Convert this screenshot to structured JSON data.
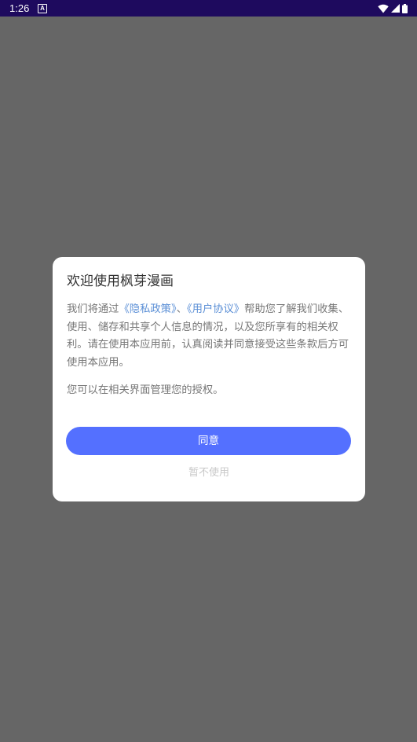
{
  "status_bar": {
    "time": "1:26",
    "notification_letter": "A",
    "icons": [
      "wifi-icon",
      "signal-icon",
      "battery-icon"
    ]
  },
  "dialog": {
    "title": "欢迎使用枫芽漫画",
    "body_part1": "我们将通过",
    "privacy_link": "《隐私政策》",
    "separator": "、",
    "agreement_link": "《用户协议》",
    "body_part2": "帮助您了解我们收集、使用、储存和共享个人信息的情况，以及您所享有的相关权利。请在使用本应用前，认真阅读并同意接受这些条款后方可使用本应用。",
    "note": "您可以在相关界面管理您的授权。",
    "agree_label": "同意",
    "decline_label": "暂不使用"
  },
  "colors": {
    "status_bar": "#1e0a5e",
    "overlay": "#666666",
    "accent": "#5470ff",
    "link": "#5b8fd6"
  }
}
